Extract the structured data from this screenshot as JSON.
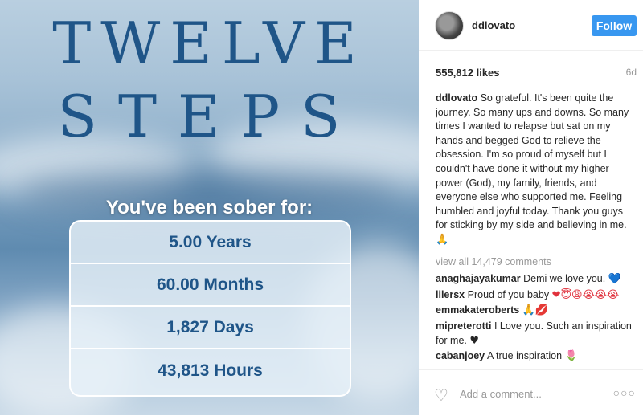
{
  "photo": {
    "title_line1": "TWELVE",
    "title_line2": "STEPS",
    "sober_label": "You've been sober for:",
    "stats": [
      "5.00 Years",
      "60.00 Months",
      "1,827 Days",
      "43,813 Hours"
    ]
  },
  "header": {
    "username": "ddlovato",
    "follow_label": "Follow"
  },
  "post": {
    "likes": "555,812 likes",
    "age": "6d",
    "caption_user": "ddlovato",
    "caption_text": "So grateful. It's been quite the journey. So many ups and downs. So many times I wanted to relapse but sat on my hands and begged God to relieve the obsession. I'm so proud of myself but I couldn't have done it without my higher power (God), my family, friends, and everyone else who supported me. Feeling humbled and joyful today. Thank you guys for sticking by my side and believing in me.",
    "caption_emoji": "🙏",
    "view_all": "view all 14,479 comments"
  },
  "comments": [
    {
      "user": "anaghajayakumar",
      "text": "Demi we love you.",
      "emoji": "💙"
    },
    {
      "user": "lilersx",
      "text": "Proud of you baby",
      "emoji": "❤😇😩😭😭😭"
    },
    {
      "user": "emmakateroberts",
      "text": "",
      "emoji": "🙏💋"
    },
    {
      "user": "mipreterotti",
      "text": "I Love you. Such an inspiration for me.",
      "emoji": "♥"
    },
    {
      "user": "cabanjoey",
      "text": "A true inspiration",
      "emoji": "🌷"
    }
  ],
  "footer": {
    "add_comment_placeholder": "Add a comment...",
    "like_icon": "heart-outline-icon",
    "more_icon": "more-options-icon"
  },
  "colors": {
    "accent": "#3897f0",
    "title": "#1f5588"
  }
}
